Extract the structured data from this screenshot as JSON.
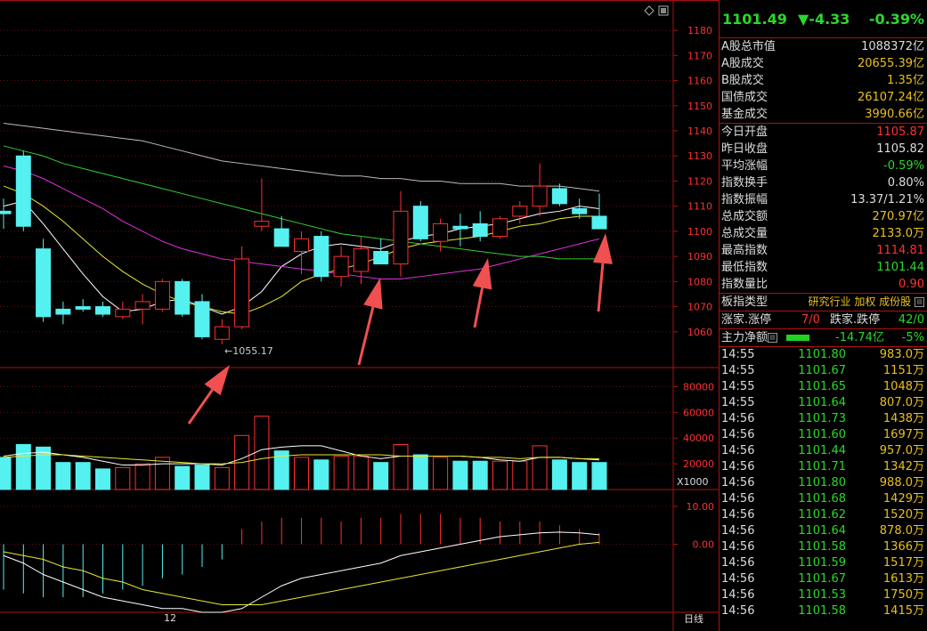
{
  "quote": {
    "price": "1101.49",
    "change": "▼-4.33",
    "change_pct": "-0.39%"
  },
  "market_stats": [
    {
      "label": "A股总市值",
      "value": "1088372亿",
      "color": "white"
    },
    {
      "label": "A股成交",
      "value": "20655.39亿",
      "color": "yellow"
    },
    {
      "label": "B股成交",
      "value": "1.35亿",
      "color": "yellow"
    },
    {
      "label": "国债成交",
      "value": "26107.24亿",
      "color": "yellow"
    },
    {
      "label": "基金成交",
      "value": "3990.66亿",
      "color": "yellow"
    }
  ],
  "index_stats": [
    {
      "label": "今日开盘",
      "value": "1105.87",
      "color": "red"
    },
    {
      "label": "昨日收盘",
      "value": "1105.82",
      "color": "white"
    },
    {
      "label": "平均涨幅",
      "value": "-0.59%",
      "color": "green"
    },
    {
      "label": "指数换手",
      "value": "0.80%",
      "color": "white"
    },
    {
      "label": "指数振幅",
      "value": "13.37/1.21%",
      "color": "white"
    },
    {
      "label": "总成交额",
      "value": "270.97亿",
      "color": "yellow"
    },
    {
      "label": "总成交量",
      "value": "2133.0万",
      "color": "yellow"
    },
    {
      "label": "最高指数",
      "value": "1114.81",
      "color": "red"
    },
    {
      "label": "最低指数",
      "value": "1101.44",
      "color": "green"
    },
    {
      "label": "指数量比",
      "value": "0.90",
      "color": "red"
    }
  ],
  "sector": {
    "label": "板指类型",
    "tags": "研究行业 加权 成份股"
  },
  "breadth": {
    "up_label": "涨家.涨停",
    "up_value": "7/0",
    "down_label": "跌家.跌停",
    "down_value": "42/0"
  },
  "net_flow": {
    "label": "主力净额",
    "amount": "-14.74亿",
    "pct": "-5%"
  },
  "ticks": [
    {
      "time": "14:55",
      "price": "1101.80",
      "vol": "983.0万"
    },
    {
      "time": "14:55",
      "price": "1101.67",
      "vol": "1151万"
    },
    {
      "time": "14:55",
      "price": "1101.65",
      "vol": "1048万"
    },
    {
      "time": "14:55",
      "price": "1101.64",
      "vol": "807.0万"
    },
    {
      "time": "14:56",
      "price": "1101.73",
      "vol": "1438万"
    },
    {
      "time": "14:56",
      "price": "1101.60",
      "vol": "1697万"
    },
    {
      "time": "14:56",
      "price": "1101.44",
      "vol": "957.0万"
    },
    {
      "time": "14:56",
      "price": "1101.71",
      "vol": "1342万"
    },
    {
      "time": "14:56",
      "price": "1101.80",
      "vol": "988.0万"
    },
    {
      "time": "14:56",
      "price": "1101.68",
      "vol": "1429万"
    },
    {
      "time": "14:56",
      "price": "1101.62",
      "vol": "1520万"
    },
    {
      "time": "14:56",
      "price": "1101.64",
      "vol": "878.0万"
    },
    {
      "time": "14:56",
      "price": "1101.58",
      "vol": "1366万"
    },
    {
      "time": "14:56",
      "price": "1101.59",
      "vol": "1517万"
    },
    {
      "time": "14:56",
      "price": "1101.67",
      "vol": "1613万"
    },
    {
      "time": "14:56",
      "price": "1101.53",
      "vol": "1750万"
    },
    {
      "time": "14:56",
      "price": "1101.58",
      "vol": "1415万"
    }
  ],
  "chart_labels": {
    "low_marker": "1055.17",
    "vol_unit": "X1000",
    "month_label": "12",
    "period_label": "日线"
  },
  "chart_data": {
    "type": "candlestick",
    "price_axis": [
      1060,
      1070,
      1080,
      1090,
      1100,
      1110,
      1120,
      1130,
      1140,
      1150,
      1160,
      1170,
      1180
    ],
    "price_range": [
      1050,
      1185
    ],
    "volume_axis": [
      20000,
      40000,
      60000,
      80000
    ],
    "volume_range": [
      0,
      90000
    ],
    "macd_axis": [
      "0.00",
      "10.00"
    ],
    "macd_range": [
      -18,
      14
    ],
    "low_annotation": 1055.17,
    "candles": [
      {
        "o": 1108,
        "h": 1113,
        "l": 1101,
        "c": 1107,
        "v": 25000
      },
      {
        "o": 1130,
        "h": 1132,
        "l": 1100,
        "c": 1102,
        "v": 35000
      },
      {
        "o": 1093,
        "h": 1097,
        "l": 1064,
        "c": 1066,
        "v": 33000
      },
      {
        "o": 1069,
        "h": 1072,
        "l": 1063,
        "c": 1067,
        "v": 21000
      },
      {
        "o": 1070,
        "h": 1073,
        "l": 1068,
        "c": 1069,
        "v": 21000
      },
      {
        "o": 1070,
        "h": 1072,
        "l": 1066,
        "c": 1067,
        "v": 16000
      },
      {
        "o": 1066,
        "h": 1072,
        "l": 1065,
        "c": 1069,
        "v": 17000
      },
      {
        "o": 1069,
        "h": 1075,
        "l": 1063,
        "c": 1072,
        "v": 20000
      },
      {
        "o": 1069,
        "h": 1081,
        "l": 1068,
        "c": 1080,
        "v": 25000
      },
      {
        "o": 1080,
        "h": 1081,
        "l": 1066,
        "c": 1067,
        "v": 18000
      },
      {
        "o": 1072,
        "h": 1075,
        "l": 1057,
        "c": 1058,
        "v": 19000
      },
      {
        "o": 1057,
        "h": 1065,
        "l": 1055,
        "c": 1062,
        "v": 17000
      },
      {
        "o": 1062,
        "h": 1094,
        "l": 1061,
        "c": 1089,
        "v": 42000
      },
      {
        "o": 1102,
        "h": 1121,
        "l": 1100,
        "c": 1104,
        "v": 57000
      },
      {
        "o": 1101,
        "h": 1106,
        "l": 1096,
        "c": 1094,
        "v": 30000
      },
      {
        "o": 1092,
        "h": 1100,
        "l": 1083,
        "c": 1097,
        "v": 25000
      },
      {
        "o": 1098,
        "h": 1100,
        "l": 1080,
        "c": 1082,
        "v": 23000
      },
      {
        "o": 1082,
        "h": 1094,
        "l": 1078,
        "c": 1090,
        "v": 26000
      },
      {
        "o": 1084,
        "h": 1098,
        "l": 1079,
        "c": 1093,
        "v": 26000
      },
      {
        "o": 1092,
        "h": 1097,
        "l": 1087,
        "c": 1087,
        "v": 21000
      },
      {
        "o": 1087,
        "h": 1116,
        "l": 1082,
        "c": 1108,
        "v": 35000
      },
      {
        "o": 1110,
        "h": 1112,
        "l": 1096,
        "c": 1097,
        "v": 27000
      },
      {
        "o": 1096,
        "h": 1105,
        "l": 1092,
        "c": 1103,
        "v": 25000
      },
      {
        "o": 1102,
        "h": 1107,
        "l": 1094,
        "c": 1101,
        "v": 22000
      },
      {
        "o": 1103,
        "h": 1108,
        "l": 1096,
        "c": 1098,
        "v": 22000
      },
      {
        "o": 1098,
        "h": 1106,
        "l": 1097,
        "c": 1105,
        "v": 22000
      },
      {
        "o": 1106,
        "h": 1112,
        "l": 1103,
        "c": 1110,
        "v": 22000
      },
      {
        "o": 1110,
        "h": 1127,
        "l": 1106,
        "c": 1118,
        "v": 34000
      },
      {
        "o": 1117,
        "h": 1119,
        "l": 1110,
        "c": 1111,
        "v": 23000
      },
      {
        "o": 1109,
        "h": 1113,
        "l": 1105,
        "c": 1107,
        "v": 21000
      },
      {
        "o": 1106,
        "h": 1115,
        "l": 1101,
        "c": 1101,
        "v": 21000
      }
    ],
    "series": [
      {
        "name": "MA5",
        "color": "#ffffff",
        "values": [
          1110,
          1112,
          1103,
          1093,
          1083,
          1074,
          1068,
          1069,
          1072,
          1073,
          1070,
          1067,
          1070,
          1076,
          1086,
          1091,
          1094,
          1095,
          1094,
          1093,
          1096,
          1098,
          1099,
          1101,
          1102,
          1103,
          1105,
          1107,
          1108,
          1110,
          1109
        ]
      },
      {
        "name": "MA10",
        "color": "#e8e830",
        "values": [
          1118,
          1115,
          1110,
          1104,
          1097,
          1090,
          1084,
          1079,
          1075,
          1072,
          1070,
          1068,
          1067,
          1070,
          1074,
          1080,
          1083,
          1085,
          1087,
          1090,
          1093,
          1095,
          1096,
          1097,
          1098,
          1100,
          1102,
          1103,
          1105,
          1106,
          1106
        ]
      },
      {
        "name": "MA20",
        "color": "#e030e0",
        "values": [
          1126,
          1124,
          1121,
          1117,
          1113,
          1109,
          1104,
          1100,
          1096,
          1093,
          1091,
          1089,
          1088,
          1087,
          1086,
          1085,
          1084,
          1083,
          1082,
          1081,
          1081,
          1082,
          1083,
          1084,
          1085,
          1087,
          1089,
          1091,
          1093,
          1095,
          1097
        ]
      },
      {
        "name": "MA30",
        "color": "#30d030",
        "values": [
          1134,
          1132,
          1130,
          1127,
          1125,
          1123,
          1121,
          1119,
          1117,
          1115,
          1113,
          1111,
          1109,
          1107,
          1105,
          1103,
          1101,
          1099,
          1098,
          1097,
          1096,
          1095,
          1094,
          1093,
          1092,
          1091,
          1090,
          1090,
          1089,
          1089,
          1089
        ]
      },
      {
        "name": "MA60",
        "color": "#bbbbbb",
        "values": [
          1143,
          1142,
          1141,
          1140,
          1139,
          1138,
          1137,
          1136,
          1134,
          1132,
          1130,
          1128,
          1127,
          1126,
          1125,
          1124,
          1123,
          1122,
          1122,
          1121,
          1121,
          1120,
          1120,
          1119,
          1119,
          1119,
          1118,
          1118,
          1118,
          1117,
          1116
        ]
      }
    ],
    "volume_ma": [
      {
        "name": "VMA5",
        "color": "#ffffff",
        "values": [
          26000,
          28000,
          29000,
          27000,
          25000,
          22000,
          19000,
          19000,
          20000,
          20000,
          20000,
          19000,
          24000,
          31000,
          33000,
          34000,
          34000,
          30000,
          26000,
          24000,
          26000,
          26000,
          26000,
          26000,
          25000,
          23000,
          22000,
          25000,
          25000,
          24000,
          23000
        ]
      },
      {
        "name": "VMA10",
        "color": "#e8e830",
        "values": [
          25000,
          26000,
          27000,
          27000,
          26000,
          25000,
          24000,
          23000,
          22000,
          21000,
          20000,
          20000,
          21000,
          24000,
          26000,
          27000,
          27000,
          27000,
          27000,
          27000,
          26000,
          26000,
          26000,
          26000,
          25000,
          25000,
          24000,
          25000,
          25000,
          24000,
          24000
        ]
      }
    ],
    "macd_hist": [
      -12,
      -13,
      -14,
      -14,
      -14,
      -13,
      -12,
      -11,
      -9,
      -8,
      -6,
      -4,
      4,
      6,
      7,
      7,
      7,
      6,
      7,
      7,
      8,
      8,
      8,
      7,
      7,
      6,
      6,
      6,
      5,
      4,
      3
    ],
    "macd_dif": [
      -3,
      -5,
      -8,
      -10,
      -12,
      -14,
      -15,
      -16,
      -17,
      -17,
      -18,
      -18,
      -17,
      -14,
      -11,
      -9,
      -8,
      -7,
      -6,
      -5,
      -3,
      -2,
      -1,
      0,
      1,
      2,
      2.5,
      3,
      3.2,
      3,
      2.5
    ],
    "macd_dea": [
      -2,
      -3,
      -4,
      -6,
      -7,
      -9,
      -10,
      -12,
      -13,
      -14,
      -15,
      -16,
      -16,
      -16,
      -15,
      -14,
      -13,
      -12,
      -11,
      -10,
      -9,
      -8,
      -7,
      -6,
      -5,
      -4,
      -3,
      -2,
      -1,
      0,
      0.5
    ]
  }
}
